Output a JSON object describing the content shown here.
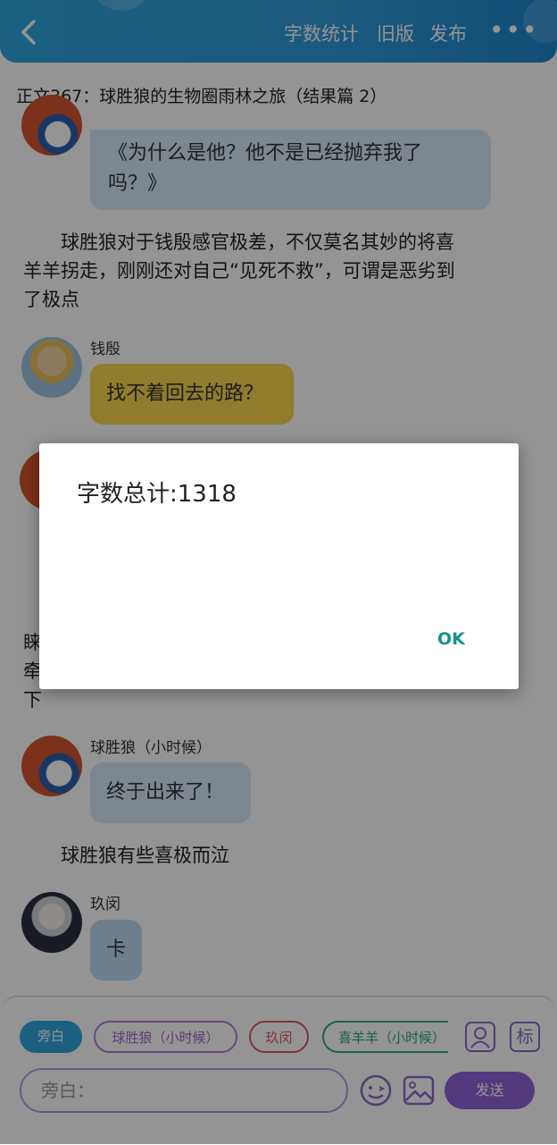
{
  "header": {
    "actions": [
      "字数统计",
      "旧版",
      "发布"
    ],
    "chapter_title": "正文367：球胜狼的生物圈雨林之旅（结果篇 2）"
  },
  "messages": {
    "bubble1": "《为什么是他？他不是已经抛弃我了吗？》",
    "bubble1_line1": "《为什么是他？他不是已经抛弃我了",
    "bubble1_line2": "吗？》",
    "narration1_l1": "球胜狼对于钱殷感官极差，不仅莫名其妙的将喜",
    "narration1_l2": "羊羊拐走，刚刚还对自己“见死不救”，可谓是恶劣到",
    "narration1_l3": "了极点",
    "name2": "钱殷",
    "bubble2": "找不着回去的路？",
    "fragment_a": "睐",
    "fragment_b": "牵",
    "fragment_c": "下",
    "name3": "球胜狼（小时候）",
    "bubble3": "终于出来了！",
    "narration2": "球胜狼有些喜极而泣",
    "name4": "玖闵",
    "bubble4": "卡"
  },
  "dialog": {
    "message": "字数总计:1318",
    "ok_label": "OK"
  },
  "composer": {
    "roles": [
      "旁白",
      "球胜狼（小时候）",
      "玖闵",
      "喜羊羊（小时候）"
    ],
    "input_placeholder": "旁白：",
    "send_label": "发送",
    "tag_label": "标"
  },
  "colors": {
    "header_blue": "#2f9ad8",
    "bubble_blue": "#d6e8f8",
    "bubble_yellow": "#f8d64c",
    "accent_purple": "#8e63d8",
    "ok_teal": "#16928e"
  }
}
